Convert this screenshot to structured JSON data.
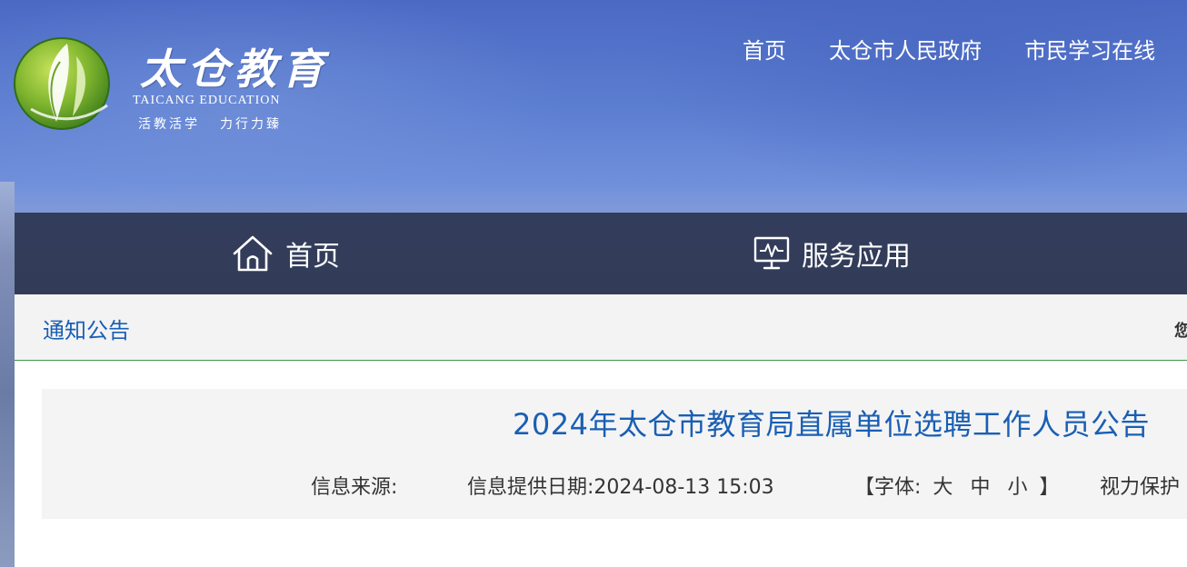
{
  "brand": {
    "name_cn": "太仓教育",
    "name_en": "TAICANG EDUCATION",
    "slogan_left": "活教活学",
    "slogan_right": "力行力臻"
  },
  "top_nav": [
    "首页",
    "太仓市人民政府",
    "市民学习在线"
  ],
  "main_nav": {
    "home_label": "首页",
    "service_label": "服务应用"
  },
  "breadcrumb": {
    "section_title": "通知公告",
    "location_prefix": "您"
  },
  "article": {
    "title": "2024年太仓市教育局直属单位选聘工作人员公告",
    "source_label": "信息来源:",
    "date_label": "信息提供日期:",
    "date_value": "2024-08-13 15:03",
    "font_open": "【字体:",
    "font_large": "大",
    "font_medium": "中",
    "font_small": "小",
    "font_close": "】",
    "eye_protection": "视力保护"
  },
  "colors": {
    "title_blue": "#1a5fb4",
    "nav_bar": "#2c3652",
    "divider_green": "#3d9a4b"
  }
}
